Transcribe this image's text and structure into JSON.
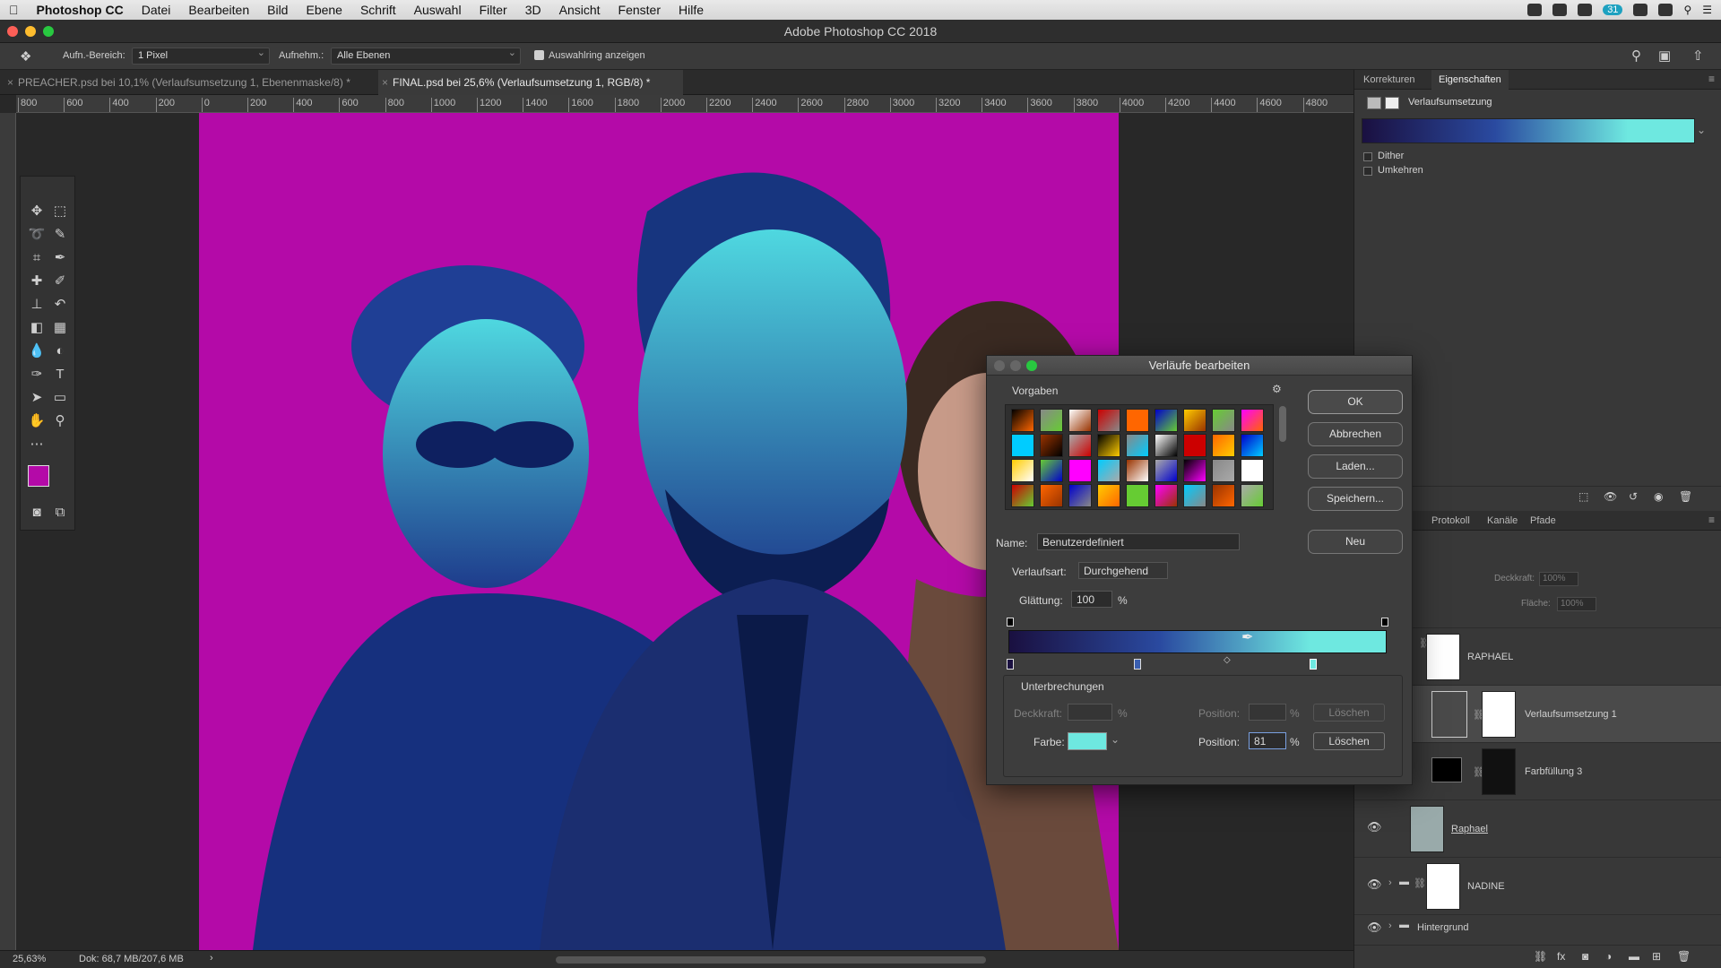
{
  "menubar": {
    "app": "Photoshop CC",
    "items": [
      "Datei",
      "Bearbeiten",
      "Bild",
      "Ebene",
      "Schrift",
      "Auswahl",
      "Filter",
      "3D",
      "Ansicht",
      "Fenster",
      "Hilfe"
    ],
    "battery_badge": "31"
  },
  "window": {
    "title": "Adobe Photoshop CC 2018"
  },
  "options": {
    "sample_size_label": "Aufn.-Bereich:",
    "sample_size_value": "1 Pixel",
    "sample_label": "Aufnehm.:",
    "sample_value": "Alle Ebenen",
    "show_ring_label": "Auswahlring anzeigen"
  },
  "tabs": [
    {
      "label": "PREACHER.psd bei 10,1% (Verlaufsumsetzung 1, Ebenenmaske/8) *"
    },
    {
      "label": "FINAL.psd bei 25,6% (Verlaufsumsetzung 1, RGB/8) *"
    }
  ],
  "ruler_ticks": [
    "800",
    "600",
    "400",
    "200",
    "0",
    "200",
    "400",
    "600",
    "800",
    "1000",
    "1200",
    "1400",
    "1600",
    "1800",
    "2000",
    "2200",
    "2400",
    "2600",
    "2800",
    "3000",
    "3200",
    "3400",
    "3600",
    "3800",
    "4000",
    "4200",
    "4400",
    "4600",
    "4800"
  ],
  "status": {
    "zoom": "25,63%",
    "doc": "Dok: 68,7 MB/207,6 MB"
  },
  "properties": {
    "tabs": [
      "Korrekturen",
      "Eigenschaften"
    ],
    "title": "Verlaufsumsetzung",
    "dither": "Dither",
    "reverse": "Umkehren"
  },
  "layers_panel": {
    "tabs": [
      "Protokoll",
      "Kanäle",
      "Pfade"
    ],
    "opacity_label": "Deckkraft:",
    "opacity_value": "100%",
    "fill_label": "Fläche:",
    "fill_value": "100%",
    "layers": [
      {
        "name": "RAPHAEL"
      },
      {
        "name": "Verlaufsumsetzung 1"
      },
      {
        "name": "Farbfüllung 3"
      },
      {
        "name": "Raphael"
      },
      {
        "name": "NADINE"
      },
      {
        "name": "Hintergrund"
      }
    ]
  },
  "dialog": {
    "title": "Verläufe bearbeiten",
    "presets_label": "Vorgaben",
    "ok": "OK",
    "cancel": "Abbrechen",
    "load": "Laden...",
    "save": "Speichern...",
    "new": "Neu",
    "name_label": "Name:",
    "name_value": "Benutzerdefiniert",
    "type_label": "Verlaufsart:",
    "type_value": "Durchgehend",
    "smooth_label": "Glättung:",
    "smooth_value": "100",
    "percent": "%",
    "stops_label": "Unterbrechungen",
    "opacity_label": "Deckkraft:",
    "color_label": "Farbe:",
    "position_label": "Position:",
    "position_value": "81",
    "delete": "Löschen",
    "gradient_start": "#1a1040",
    "gradient_end": "#6ee8e0",
    "color_stop_value": "#6ee8e0"
  },
  "colors": {
    "foreground": "#b40aa8",
    "background": "#000000"
  }
}
